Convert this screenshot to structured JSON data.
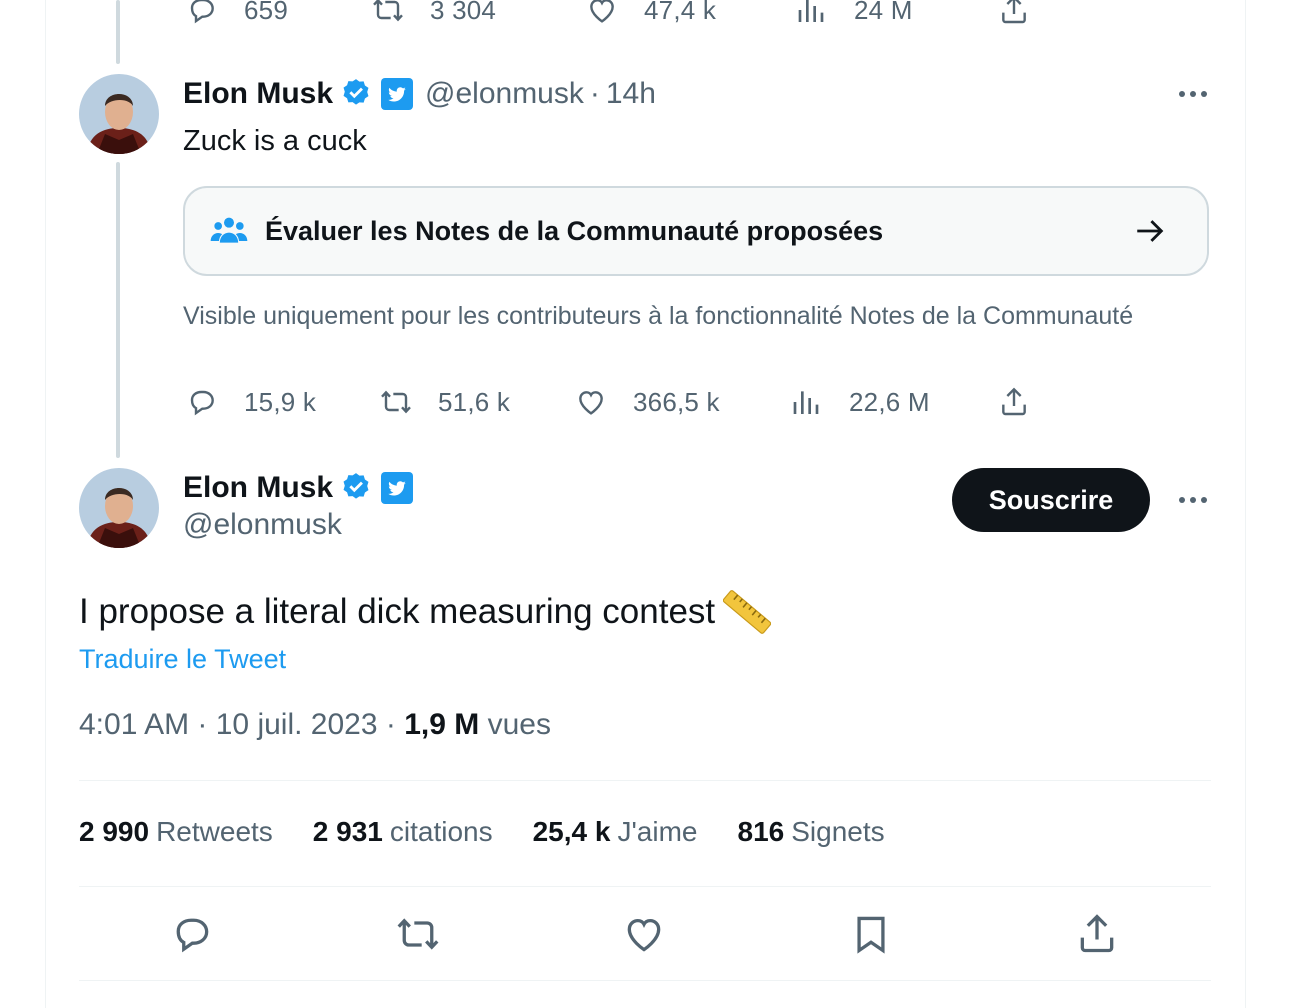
{
  "top_actions": {
    "replies": "659",
    "retweets": "3 304",
    "likes": "47,4 k",
    "views": "24 M"
  },
  "reply_tweet": {
    "author_name": "Elon Musk",
    "handle": "@elonmusk",
    "time": "14h",
    "text": "Zuck is a cuck",
    "community_notes_label": "Évaluer les Notes de la Communauté proposées",
    "visibility_info": "Visible uniquement pour les contributeurs à la fonctionnalité Notes de la Communauté",
    "replies": "15,9 k",
    "retweets": "51,6 k",
    "likes": "366,5 k",
    "views": "22,6 M"
  },
  "main_tweet": {
    "author_name": "Elon Musk",
    "handle": "@elonmusk",
    "subscribe_label": "Souscrire",
    "text": "I propose a literal dick measuring contest",
    "translate_label": "Traduire le Tweet",
    "time": "4:01 AM",
    "date": "10 juil. 2023",
    "views_count": "1,9 M",
    "views_label": "vues",
    "stats": [
      {
        "num": "2 990",
        "label": "Retweets"
      },
      {
        "num": "2 931",
        "label": "citations"
      },
      {
        "num": "25,4 k",
        "label": "J'aime"
      },
      {
        "num": "816",
        "label": "Signets"
      }
    ]
  },
  "colors": {
    "accent": "#1d9bf0",
    "text_primary": "#0f1419",
    "text_secondary": "#536471",
    "border": "#cfd9de"
  },
  "icons": [
    "reply-icon",
    "retweet-icon",
    "like-icon",
    "views-icon",
    "share-icon",
    "verified-icon",
    "twitter-badge-icon",
    "community-notes-icon",
    "arrow-right-icon",
    "more-icon",
    "ruler-emoji",
    "bookmark-icon"
  ]
}
